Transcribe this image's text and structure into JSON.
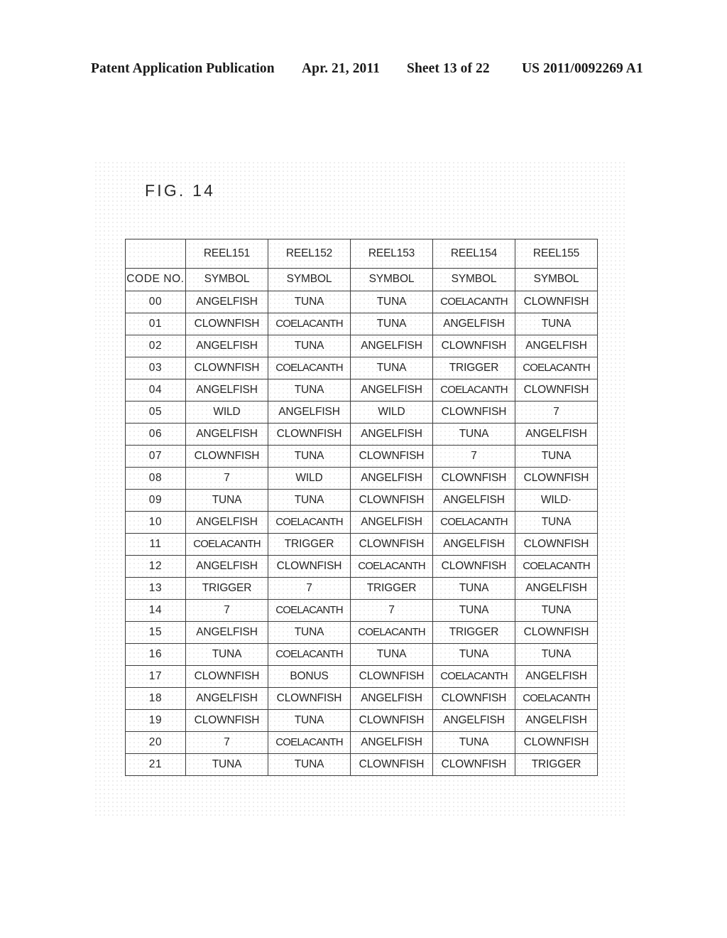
{
  "header": {
    "publication": "Patent Application Publication",
    "date": "Apr. 21, 2011",
    "sheet": "Sheet 13 of 22",
    "doc_number": "US 2011/0092269 A1"
  },
  "figure": {
    "label": "FIG. 14"
  },
  "table": {
    "corner_blank": "",
    "reel_headers": [
      "REEL151",
      "REEL152",
      "REEL153",
      "REEL154",
      "REEL155"
    ],
    "code_header": "CODE NO.",
    "symbol_header": "SYMBOL",
    "rows": [
      {
        "code": "00",
        "symbols": [
          "ANGELFISH",
          "TUNA",
          "TUNA",
          "COELACANTH",
          "CLOWNFISH"
        ]
      },
      {
        "code": "01",
        "symbols": [
          "CLOWNFISH",
          "COELACANTH",
          "TUNA",
          "ANGELFISH",
          "TUNA"
        ]
      },
      {
        "code": "02",
        "symbols": [
          "ANGELFISH",
          "TUNA",
          "ANGELFISH",
          "CLOWNFISH",
          "ANGELFISH"
        ]
      },
      {
        "code": "03",
        "symbols": [
          "CLOWNFISH",
          "COELACANTH",
          "TUNA",
          "TRIGGER",
          "COELACANTH"
        ]
      },
      {
        "code": "04",
        "symbols": [
          "ANGELFISH",
          "TUNA",
          "ANGELFISH",
          "COELACANTH",
          "CLOWNFISH"
        ]
      },
      {
        "code": "05",
        "symbols": [
          "WILD",
          "ANGELFISH",
          "WILD",
          "CLOWNFISH",
          "7"
        ]
      },
      {
        "code": "06",
        "symbols": [
          "ANGELFISH",
          "CLOWNFISH",
          "ANGELFISH",
          "TUNA",
          "ANGELFISH"
        ]
      },
      {
        "code": "07",
        "symbols": [
          "CLOWNFISH",
          "TUNA",
          "CLOWNFISH",
          "7",
          "TUNA"
        ]
      },
      {
        "code": "08",
        "symbols": [
          "7",
          "WILD",
          "ANGELFISH",
          "CLOWNFISH",
          "CLOWNFISH"
        ]
      },
      {
        "code": "09",
        "symbols": [
          "TUNA",
          "TUNA",
          "CLOWNFISH",
          "ANGELFISH",
          "WILD·"
        ]
      },
      {
        "code": "10",
        "symbols": [
          "ANGELFISH",
          "COELACANTH",
          "ANGELFISH",
          "COELACANTH",
          "TUNA"
        ]
      },
      {
        "code": "11",
        "symbols": [
          "COELACANTH",
          "TRIGGER",
          "CLOWNFISH",
          "ANGELFISH",
          "CLOWNFISH"
        ]
      },
      {
        "code": "12",
        "symbols": [
          "ANGELFISH",
          "CLOWNFISH",
          "COELACANTH",
          "CLOWNFISH",
          "COELACANTH"
        ]
      },
      {
        "code": "13",
        "symbols": [
          "TRIGGER",
          "7",
          "TRIGGER",
          "TUNA",
          "ANGELFISH"
        ]
      },
      {
        "code": "14",
        "symbols": [
          "7",
          "COELACANTH",
          "7",
          "TUNA",
          "TUNA"
        ]
      },
      {
        "code": "15",
        "symbols": [
          "ANGELFISH",
          "TUNA",
          "COELACANTH",
          "TRIGGER",
          "CLOWNFISH"
        ]
      },
      {
        "code": "16",
        "symbols": [
          "TUNA",
          "COELACANTH",
          "TUNA",
          "TUNA",
          "TUNA"
        ]
      },
      {
        "code": "17",
        "symbols": [
          "CLOWNFISH",
          "BONUS",
          "CLOWNFISH",
          "COELACANTH",
          "ANGELFISH"
        ]
      },
      {
        "code": "18",
        "symbols": [
          "ANGELFISH",
          "CLOWNFISH",
          "ANGELFISH",
          "CLOWNFISH",
          "COELACANTH"
        ]
      },
      {
        "code": "19",
        "symbols": [
          "CLOWNFISH",
          "TUNA",
          "CLOWNFISH",
          "ANGELFISH",
          "ANGELFISH"
        ]
      },
      {
        "code": "20",
        "symbols": [
          "7",
          "COELACANTH",
          "ANGELFISH",
          "TUNA",
          "CLOWNFISH"
        ]
      },
      {
        "code": "21",
        "symbols": [
          "TUNA",
          "TUNA",
          "CLOWNFISH",
          "CLOWNFISH",
          "TRIGGER"
        ]
      }
    ]
  }
}
